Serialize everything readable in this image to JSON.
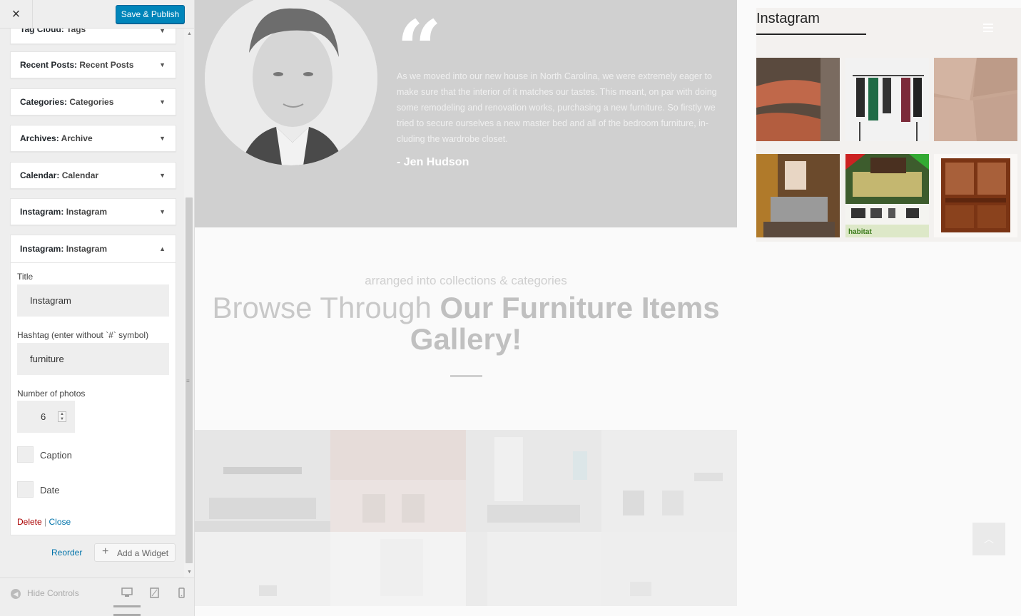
{
  "header": {
    "close_label": "×",
    "publish_label": "Save & Publish"
  },
  "widgets": [
    {
      "type": "Tag Cloud:",
      "title": "Tags"
    },
    {
      "type": "Recent Posts:",
      "title": "Recent Posts"
    },
    {
      "type": "Categories:",
      "title": "Categories"
    },
    {
      "type": "Archives:",
      "title": "Archive"
    },
    {
      "type": "Calendar:",
      "title": "Calendar"
    },
    {
      "type": "Instagram:",
      "title": "Instagram"
    }
  ],
  "open_widget": {
    "type": "Instagram:",
    "title": "Instagram",
    "title_label": "Title",
    "title_value": "Instagram",
    "hashtag_label": "Hashtag (enter without `#` symbol)",
    "hashtag_value": "furniture",
    "photos_label": "Number of photos",
    "photos_value": "6",
    "caption_label": "Caption",
    "date_label": "Date",
    "delete_label": "Delete",
    "separator": "|",
    "close_label": "Close"
  },
  "actions": {
    "reorder_label": "Reorder",
    "add_widget_label": "Add a Widget"
  },
  "footer": {
    "hide_controls_label": "Hide Controls"
  },
  "preview": {
    "testimonial_quote": "As we moved into our new house in North Carolina, we were extremely eager to make sure that the interior of it matches our tastes. This meant, on par with doing some remodeling and renovation works, purchasing a new furniture. So firstly we tried to secure ourselves a new master bed and all of the bedroom furniture, in-cluding the wardrobe closet.",
    "testimonial_author": "- Jen Hudson",
    "gallery_subtitle": "arranged into collections & categories",
    "gallery_title_light": "Browse Through ",
    "gallery_title_bold": "Our Furniture Items Gallery!",
    "instagram_title": "Instagram",
    "insta_badge_text": "habitat"
  },
  "colors": {
    "primary_button": "#0085ba",
    "link": "#0073aa",
    "delete": "#a00000"
  }
}
